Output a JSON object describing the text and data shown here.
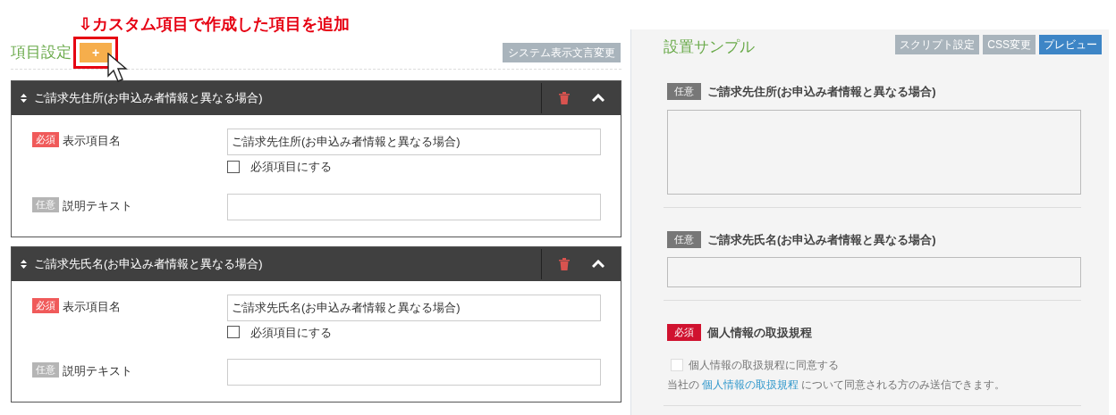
{
  "annotation": "⇩カスタム項目で作成した項目を追加",
  "left": {
    "title": "項目設定",
    "add_button": "+",
    "system_button": "システム表示文言変更",
    "items": [
      {
        "title": "ご請求先住所(お申込み者情報と異なる場合)",
        "expanded": true,
        "fields": [
          {
            "badge": {
              "kind": "required",
              "text": "必須"
            },
            "label": "表示項目名",
            "value": "ご請求先住所(お申込み者情報と異なる場合)",
            "checkbox": {
              "label": "必須項目にする",
              "checked": false
            }
          },
          {
            "badge": {
              "kind": "optional",
              "text": "任意"
            },
            "label": "説明テキスト"
          }
        ]
      },
      {
        "title": "ご請求先氏名(お申込み者情報と異なる場合)",
        "expanded": true,
        "fields": [
          {
            "badge": {
              "kind": "required",
              "text": "必須"
            },
            "label": "表示項目名",
            "value": "ご請求先氏名(お申込み者情報と異なる場合)",
            "checkbox": {
              "label": "必須項目にする",
              "checked": false
            }
          },
          {
            "badge": {
              "kind": "optional",
              "text": "任意"
            },
            "label": "説明テキスト"
          }
        ]
      }
    ]
  },
  "right": {
    "title": "設置サンプル",
    "buttons": [
      {
        "label": "スクリプト設定",
        "kind": "secondary"
      },
      {
        "label": "CSS変更",
        "kind": "secondary"
      },
      {
        "label": "プレビュー",
        "kind": "primary"
      }
    ],
    "samples": [
      {
        "kind": "textarea",
        "badge": {
          "kind": "optional",
          "text": "任意"
        },
        "title": "ご請求先住所(お申込み者情報と異なる場合)"
      },
      {
        "kind": "input",
        "badge": {
          "kind": "optional",
          "text": "任意"
        },
        "title": "ご請求先氏名(お申込み者情報と異なる場合)"
      },
      {
        "kind": "consent",
        "badge": {
          "kind": "required",
          "text": "必須"
        },
        "title": "個人情報の取扱規程",
        "checkbox": {
          "label": "個人情報の取扱規程に同意する",
          "checked": false
        },
        "note": {
          "before": "当社の",
          "link": "個人情報の取扱規程",
          "after": "について同意される方のみ送信できます。"
        }
      }
    ]
  }
}
